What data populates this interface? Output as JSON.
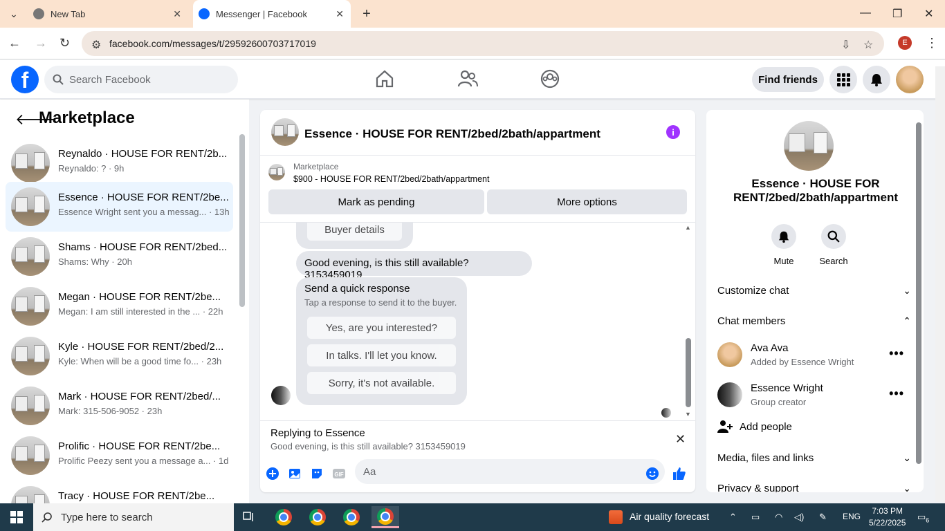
{
  "browser": {
    "tabs": [
      {
        "title": "New Tab"
      },
      {
        "title": "Messenger | Facebook"
      }
    ],
    "url": "facebook.com/messages/t/29592600703717019",
    "profile_initial": "E"
  },
  "facebook": {
    "search_placeholder": "Search Facebook",
    "find_friends": "Find friends"
  },
  "left": {
    "title": "Marketplace",
    "conversations": [
      {
        "name": "Reynaldo · HOUSE FOR RENT/2b...",
        "preview": "Reynaldo: ? · 9h"
      },
      {
        "name": "Essence · HOUSE FOR RENT/2be...",
        "preview": "Essence Wright sent you a messag... · 13h"
      },
      {
        "name": "Shams · HOUSE FOR RENT/2bed...",
        "preview": "Shams: Why · 20h"
      },
      {
        "name": "Megan · HOUSE FOR RENT/2be...",
        "preview": "Megan: I am still interested in the ... · 22h"
      },
      {
        "name": "Kyle · HOUSE FOR RENT/2bed/2...",
        "preview": "Kyle: When will be a good time fo... · 23h"
      },
      {
        "name": "Mark · HOUSE FOR RENT/2bed/...",
        "preview": "Mark: 315-506-9052 · 23h"
      },
      {
        "name": "Prolific · HOUSE FOR RENT/2be...",
        "preview": "Prolific Peezy sent you a message a... · 1d"
      },
      {
        "name": "Tracy · HOUSE FOR RENT/2be...",
        "preview": ""
      }
    ]
  },
  "chat": {
    "title": "Essence · HOUSE FOR RENT/2bed/2bath/appartment",
    "marketplace_label": "Marketplace",
    "listing": "$900 - HOUSE FOR RENT/2bed/2bath/appartment",
    "mark_pending": "Mark as pending",
    "more_options": "More options",
    "buyer_details": "Buyer details",
    "message": "Good evening, is this still available? 3153459019",
    "quick_title": "Send a quick response",
    "quick_sub": "Tap a response to send it to the buyer.",
    "quick_responses": [
      "Yes, are you interested?",
      "In talks. I'll let you know.",
      "Sorry, it's not available."
    ],
    "replying_to": "Replying to Essence",
    "replying_text": "Good evening, is this still available? 3153459019",
    "input_placeholder": "Aa"
  },
  "right": {
    "name": "Essence · HOUSE FOR RENT/2bed/2bath/appartment",
    "mute": "Mute",
    "search": "Search",
    "customize": "Customize chat",
    "members_title": "Chat members",
    "members": [
      {
        "name": "Ava Ava",
        "role": "Added by Essence Wright"
      },
      {
        "name": "Essence Wright",
        "role": "Group creator"
      }
    ],
    "add_people": "Add people",
    "media": "Media, files and links",
    "privacy": "Privacy & support"
  },
  "taskbar": {
    "search_placeholder": "Type here to search",
    "weather": "Air quality forecast",
    "lang": "ENG",
    "time": "7:03 PM",
    "date": "5/22/2025",
    "notif_count": "6"
  }
}
